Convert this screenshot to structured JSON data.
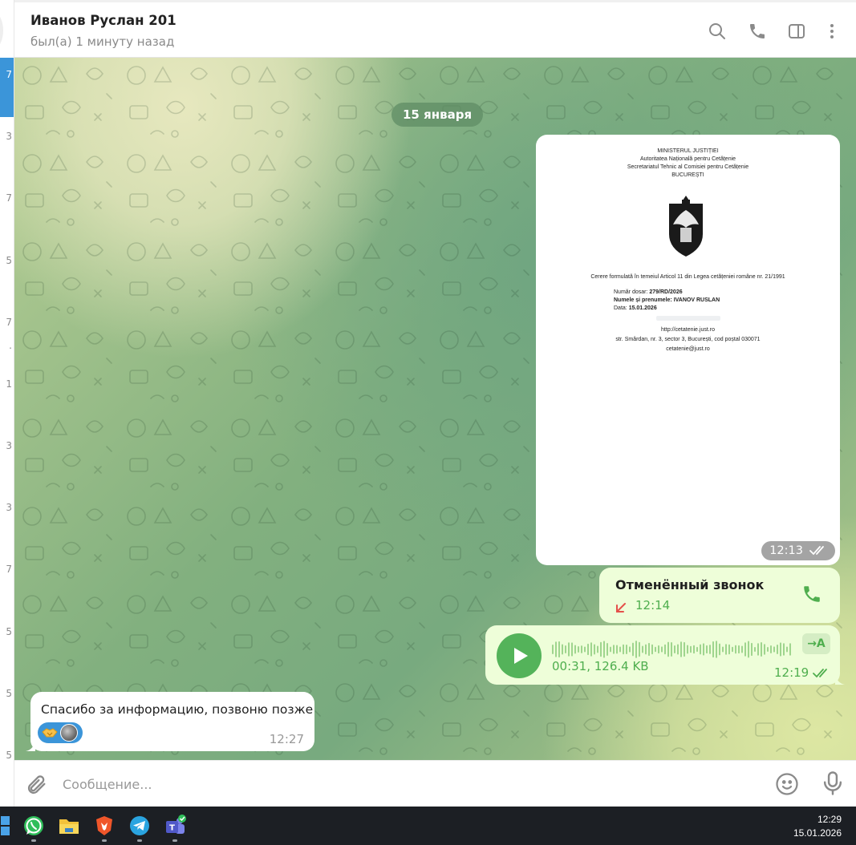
{
  "left_strip": {
    "items": [
      "7",
      "3",
      "7",
      "5",
      "7",
      ".",
      "1",
      "3",
      "3",
      "7",
      "5",
      "5",
      "5"
    ]
  },
  "header": {
    "name": "Иванов Руслан 201",
    "status": "был(а) 1 минуту назад",
    "icons": [
      "search-icon",
      "phone-icon",
      "sidebar-toggle-icon",
      "more-vertical-icon"
    ]
  },
  "chat": {
    "date_separator": "15 января",
    "document_message": {
      "time": "12:13",
      "doc_header": [
        "MINISTERUL JUSTIȚIEI",
        "Autoritatea Națională pentru Cetățenie",
        "Secretariatul Tehnic al Comisiei pentru Cetățenie",
        "BUCUREȘTI"
      ],
      "declaration": "Cerere formulată în temeiul Articol 11 din Legea cetățeniei române nr. 21/1991",
      "dosar_label": "Număr dosar:",
      "dosar_value": "279/RD/2026",
      "name_label": "Numele și prenumele:",
      "name_value": "IVANOV RUSLAN",
      "date_label": "Data:",
      "date_value": "15.01.2026",
      "contacts": [
        "http://cetatenie.just.ro",
        "str. Smârdan, nr. 3, sector 3, București, cod poștal 030071",
        "cetatenie@just.ro"
      ]
    },
    "call_message": {
      "title": "Отменённый звонок",
      "time": "12:14"
    },
    "voice_message": {
      "meta": "00:31, 126.4 KB",
      "time": "12:19",
      "transcribe_label": "→A"
    },
    "incoming_message": {
      "text": "Спасибо за информацию, позвоню позже",
      "time": "12:27",
      "reaction": "handshake-emoji"
    }
  },
  "composer": {
    "placeholder": "Сообщение..."
  },
  "taskbar": {
    "apps": [
      "windows-start-icon",
      "whatsapp-icon",
      "file-explorer-icon",
      "brave-browser-icon",
      "telegram-icon",
      "teams-icon"
    ],
    "time": "12:29",
    "date": "15.01.2026"
  },
  "colors": {
    "accent": "#3b95d9",
    "outgoing_bubble": "#eefed9",
    "outgoing_text": "#4fae4e",
    "play_button": "#54b35a",
    "missed_call": "#e5504a"
  }
}
